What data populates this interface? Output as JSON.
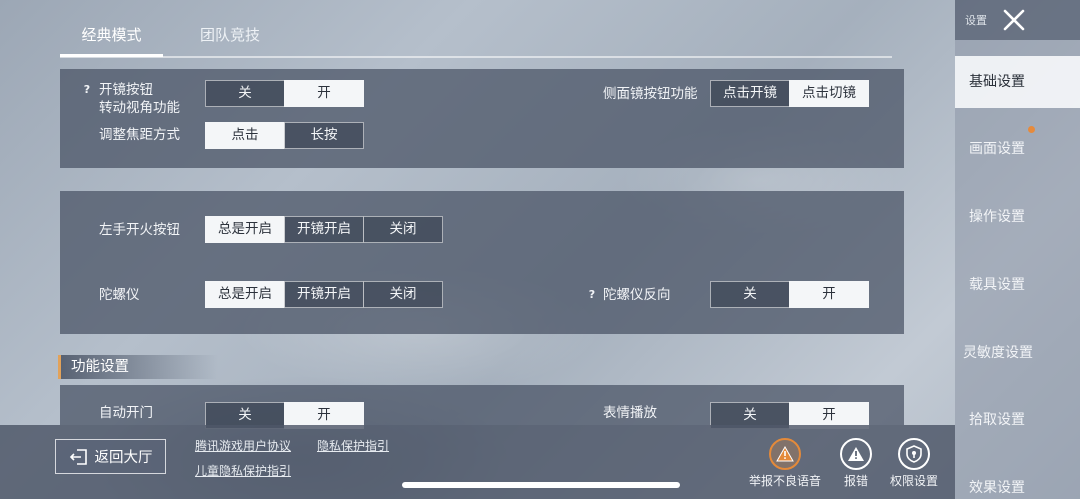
{
  "tabs": [
    {
      "label": "经典模式",
      "active": true
    },
    {
      "label": "团队竞技",
      "active": false
    }
  ],
  "panel1": {
    "scope_rotate_label_line1": "开镜按钮",
    "scope_rotate_label_line2": "转动视角功能",
    "scope_rotate_options": [
      "关",
      "开"
    ],
    "scope_rotate_selected": "开",
    "side_scope_label": "侧面镜按钮功能",
    "side_scope_options": [
      "点击开镜",
      "点击切镜"
    ],
    "side_scope_selected": "点击切镜",
    "zoom_label": "调整焦距方式",
    "zoom_options": [
      "点击",
      "长按"
    ],
    "zoom_selected": "点击"
  },
  "panel2": {
    "left_fire_label": "左手开火按钮",
    "left_fire_options": [
      "总是开启",
      "开镜开启",
      "关闭"
    ],
    "left_fire_selected": "总是开启",
    "gyro_label": "陀螺仪",
    "gyro_options": [
      "总是开启",
      "开镜开启",
      "关闭"
    ],
    "gyro_selected": "总是开启",
    "gyro_reverse_label": "陀螺仪反向",
    "gyro_reverse_options": [
      "关",
      "开"
    ],
    "gyro_reverse_selected": "开"
  },
  "section_function": {
    "title": "功能设置",
    "auto_door_label": "自动开门",
    "auto_door_options": [
      "关",
      "开"
    ],
    "auto_door_selected": "开",
    "emote_label": "表情播放",
    "emote_options": [
      "关",
      "开"
    ],
    "emote_selected": "开"
  },
  "bottom": {
    "back_label": "返回大厅",
    "link_user_agreement": "腾讯游戏用户协议",
    "link_privacy": "隐私保护指引",
    "link_child_privacy": "儿童隐私保护指引",
    "report_voice_label": "举报不良语音",
    "report_bug_label": "报错",
    "permission_label": "权限设置"
  },
  "sidebar": {
    "title": "设置",
    "items": [
      "基础设置",
      "画面设置",
      "操作设置",
      "载具设置",
      "灵敏度设置",
      "拾取设置",
      "效果设置"
    ],
    "active_index": 0
  },
  "colors": {
    "accent_orange": "#e48a3a",
    "panel_bg": "#485264",
    "selected_bg": "#f4f6f8"
  }
}
